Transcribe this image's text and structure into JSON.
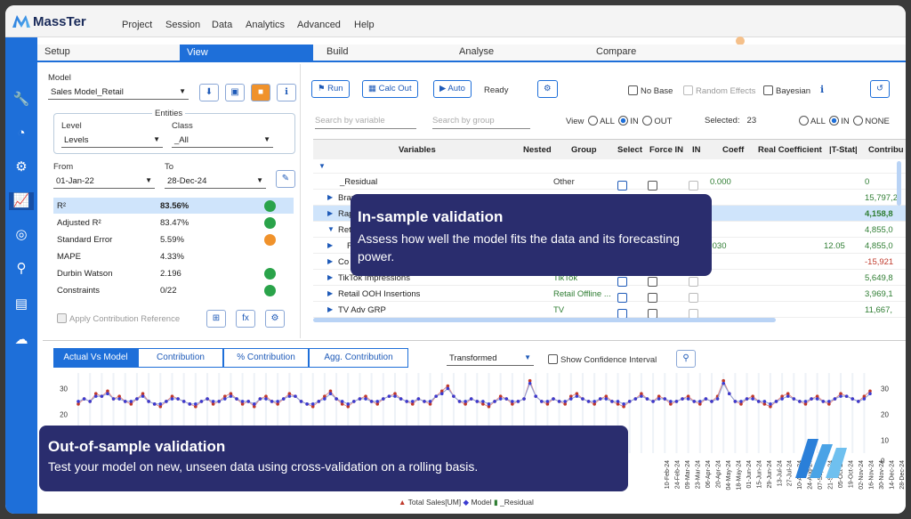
{
  "app": {
    "name": "MassTer"
  },
  "menu": [
    "Project",
    "Session",
    "Data",
    "Analytics",
    "Advanced",
    "Help"
  ],
  "tabs": [
    "Setup",
    "View",
    "Build",
    "Analyse",
    "Compare"
  ],
  "left": {
    "model_label": "Model",
    "model_value": "Sales Model_Retail",
    "entities_label": "Entities",
    "level_label": "Level",
    "level_value": "Levels",
    "class_label": "Class",
    "class_value": "_All",
    "from_label": "From",
    "from_value": "01-Jan-22",
    "to_label": "To",
    "to_value": "28-Dec-24",
    "metrics": [
      {
        "name": "R²",
        "value": "83.56%",
        "status": "#2aa34a"
      },
      {
        "name": "Adjusted R²",
        "value": "83.47%",
        "status": "#2aa34a"
      },
      {
        "name": "Standard Error",
        "value": "5.59%",
        "status": "#f0922b"
      },
      {
        "name": "MAPE",
        "value": "4.33%",
        "status": ""
      },
      {
        "name": "Durbin Watson",
        "value": "2.196",
        "status": "#2aa34a"
      },
      {
        "name": "Constraints",
        "value": "0/22",
        "status": "#2aa34a"
      }
    ],
    "apply_contribution": "Apply Contribution Reference"
  },
  "toolbar": {
    "run": "Run",
    "calc_out": "Calc Out",
    "auto": "Auto",
    "status": "Ready",
    "no_base": "No Base",
    "random_effects": "Random Effects",
    "bayesian": "Bayesian"
  },
  "filter": {
    "search_var": "Search by variable",
    "search_group": "Search by group",
    "view_label": "View",
    "all": "ALL",
    "in": "IN",
    "out": "OUT",
    "selected_label": "Selected:",
    "selected_count": "23",
    "none": "NONE"
  },
  "grid": {
    "headers": [
      "Variables",
      "Nested",
      "Group",
      "Select",
      "Force IN",
      "IN",
      "Coeff",
      "Real Coefficient",
      "|T-Stat|",
      "Contribu"
    ],
    "rows": [
      {
        "var": "_Residual",
        "group": "Other",
        "coeff": "0.000",
        "contrib": "0"
      },
      {
        "var": "Bran",
        "group": "",
        "coeff": "",
        "contrib": "15,797,2"
      },
      {
        "var": "Rap",
        "group": "",
        "coeff": "",
        "contrib": "4,158,8"
      },
      {
        "var": "Reta",
        "group": "",
        "coeff": "",
        "contrib": "4,855,0"
      },
      {
        "var": "R",
        "group": "",
        "coeff": ".030",
        "tstat": "12.05",
        "contrib": "4,855,0"
      },
      {
        "var": "Co",
        "group": "",
        "coeff": "",
        "contrib": "-15,921"
      },
      {
        "var": "TikTok Impressions",
        "group": "TikTok",
        "coeff": "",
        "contrib": "5,649,8"
      },
      {
        "var": "Retail OOH Insertions",
        "group": "Retail Offline ...",
        "coeff": "",
        "contrib": "3,969,1"
      },
      {
        "var": "TV Adv GRP",
        "group": "TV",
        "coeff": "",
        "contrib": "11,667,"
      }
    ]
  },
  "chart_tabs": [
    "Actual Vs Model",
    "Contribution",
    "% Contribution",
    "Agg. Contribution"
  ],
  "chart_mode": "Transformed",
  "show_ci": "Show Confidence Interval",
  "chart_data": {
    "type": "line",
    "y_left_ticks": [
      "30",
      "20",
      "10"
    ],
    "y_right_ticks": [
      "30",
      "20",
      "10",
      "0"
    ],
    "x_tick_labels": [
      "10-Feb-24",
      "24-Feb-24",
      "09-Mar-24",
      "23-Mar-24",
      "06-Apr-24",
      "20-Apr-24",
      "04-May-24",
      "18-May-24",
      "01-Jun-24",
      "15-Jun-24",
      "29-Jun-24",
      "13-Jul-24",
      "27-Jul-24",
      "10-Aug-24",
      "24-Aug-24",
      "07-Sep-24",
      "21-Sep-24",
      "05-Oct-24",
      "19-Oct-24",
      "02-Nov-24",
      "16-Nov-24",
      "30-Nov-24",
      "14-Dec-24",
      "28-Dec-24"
    ],
    "legend": [
      "Total Sales[UM]",
      "Model",
      "_Residual"
    ],
    "series": [
      {
        "name": "Total Sales[UM]",
        "values": [
          24,
          26,
          25,
          28,
          27,
          29,
          26,
          27,
          25,
          24,
          26,
          28,
          25,
          24,
          23,
          25,
          27,
          26,
          25,
          24,
          23,
          25,
          26,
          24,
          25,
          27,
          28,
          26,
          24,
          25,
          23,
          26,
          27,
          25,
          24,
          26,
          28,
          27,
          25,
          24,
          23,
          25,
          27,
          29,
          26,
          24,
          23,
          25,
          26,
          27,
          25,
          24,
          26,
          27,
          28,
          26,
          25,
          24,
          26,
          25,
          24,
          27,
          29,
          31,
          27,
          25,
          24,
          26,
          25,
          24,
          23,
          25,
          27,
          26,
          24,
          25,
          26,
          33,
          27,
          25,
          24,
          26,
          25,
          24,
          27,
          28,
          26,
          25,
          24,
          26,
          27,
          25,
          24,
          23,
          25,
          26,
          28,
          26,
          25,
          27,
          26,
          24,
          25,
          26,
          27,
          25,
          24,
          26,
          25,
          27,
          33,
          28,
          25,
          24,
          26,
          27,
          25,
          24,
          23,
          25,
          27,
          28,
          26,
          25,
          24,
          26,
          27,
          25,
          24,
          26,
          28,
          27,
          26,
          25,
          27,
          29
        ]
      },
      {
        "name": "Model",
        "values": [
          25,
          26,
          25,
          27,
          27,
          28,
          26,
          26,
          25,
          25,
          26,
          27,
          25,
          24,
          24,
          25,
          26,
          26,
          25,
          24,
          24,
          25,
          26,
          25,
          25,
          26,
          27,
          26,
          25,
          25,
          24,
          26,
          26,
          25,
          25,
          26,
          27,
          27,
          25,
          24,
          24,
          25,
          26,
          28,
          26,
          25,
          24,
          25,
          26,
          26,
          25,
          25,
          26,
          27,
          27,
          26,
          25,
          25,
          26,
          25,
          25,
          27,
          28,
          30,
          27,
          25,
          25,
          26,
          25,
          25,
          24,
          25,
          26,
          26,
          25,
          25,
          26,
          32,
          27,
          25,
          25,
          26,
          25,
          25,
          26,
          27,
          26,
          25,
          25,
          26,
          26,
          25,
          25,
          24,
          25,
          26,
          27,
          26,
          25,
          26,
          26,
          25,
          25,
          26,
          26,
          25,
          25,
          26,
          25,
          26,
          32,
          28,
          25,
          25,
          26,
          26,
          25,
          25,
          24,
          25,
          26,
          27,
          26,
          25,
          25,
          26,
          26,
          25,
          25,
          26,
          27,
          27,
          26,
          25,
          26,
          28
        ]
      }
    ]
  },
  "callouts": {
    "in_sample_title": "In-sample validation",
    "in_sample_text": "Assess how well the model fits the data and its forecasting power.",
    "out_sample_title": "Out-of-sample validation",
    "out_sample_text": "Test your model on new, unseen data using cross-validation on a rolling basis."
  },
  "colors": {
    "accent": "#1e6fd9",
    "callout": "#2a2d6e",
    "actual": "#c0392b",
    "model": "#3b3bd1",
    "residual": "#2e7d32"
  }
}
